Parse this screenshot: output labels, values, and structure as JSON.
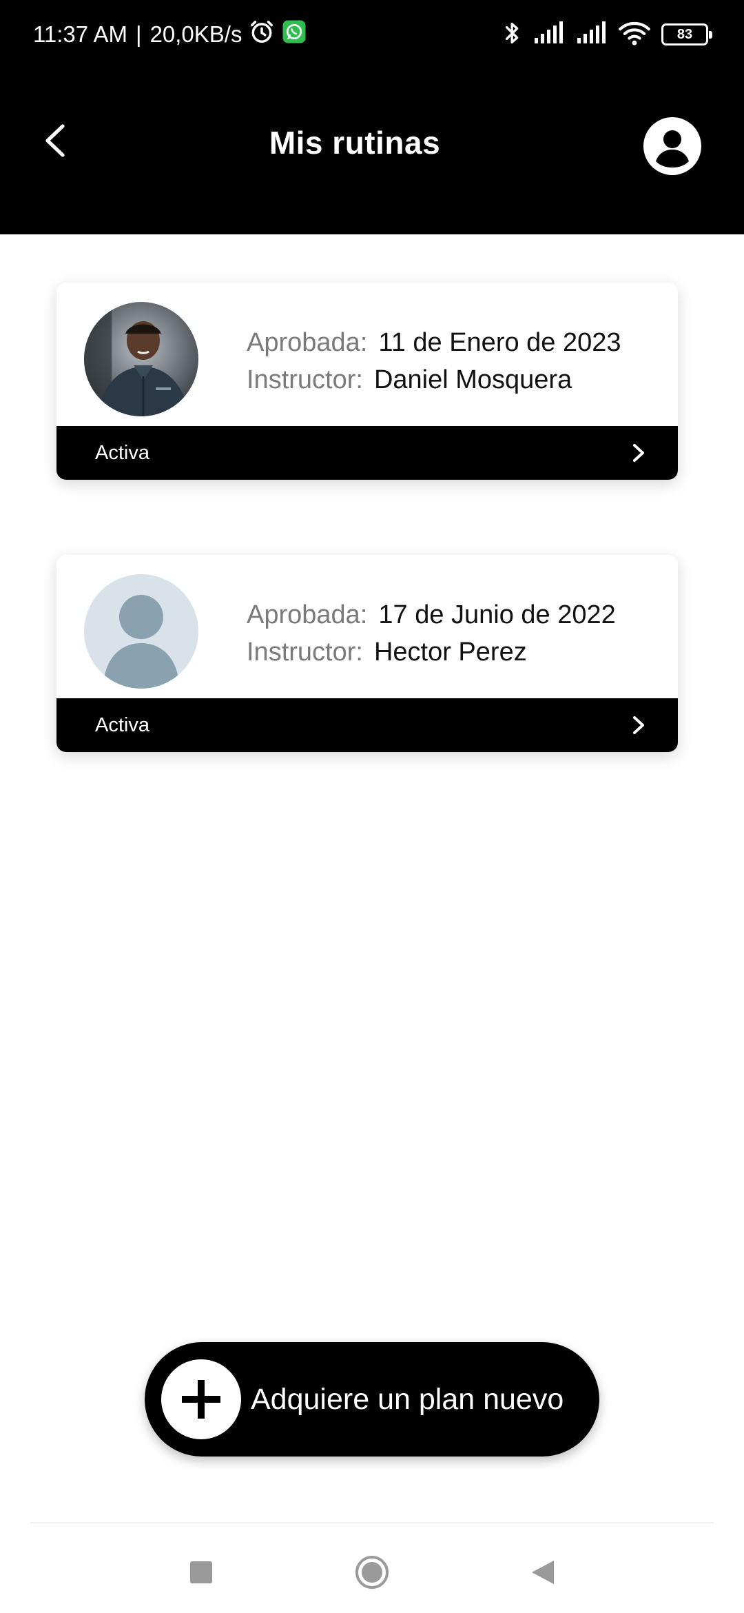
{
  "status_bar": {
    "time": "11:37 AM",
    "separator": "|",
    "network_speed": "20,0KB/s",
    "battery_level": "83",
    "icons": [
      "alarm-icon",
      "whatsapp-icon",
      "bluetooth-icon",
      "signal-icon",
      "signal-icon",
      "wifi-icon",
      "battery-icon"
    ]
  },
  "app_bar": {
    "title": "Mis rutinas",
    "back_icon": "chevron-left-icon",
    "profile_icon": "account-circle-icon"
  },
  "routines": [
    {
      "approved_label": "Aprobada:",
      "approved_date": "11 de Enero de 2023",
      "instructor_label": "Instructor:",
      "instructor_name": "Daniel Mosquera",
      "status": "Activa",
      "avatar": "instructor-photo"
    },
    {
      "approved_label": "Aprobada:",
      "approved_date": "17 de Junio de 2022",
      "instructor_label": "Instructor:",
      "instructor_name": "Hector Perez",
      "status": "Activa",
      "avatar": "default-avatar-icon"
    }
  ],
  "cta": {
    "label": "Adquiere un plan nuevo",
    "icon": "plus-icon"
  },
  "colors": {
    "primary": "#000000",
    "background": "#ffffff",
    "label_gray": "#7a7a7a",
    "avatar_placeholder_bg": "#d9e2e8",
    "avatar_placeholder_fg": "#8aa1b0"
  }
}
